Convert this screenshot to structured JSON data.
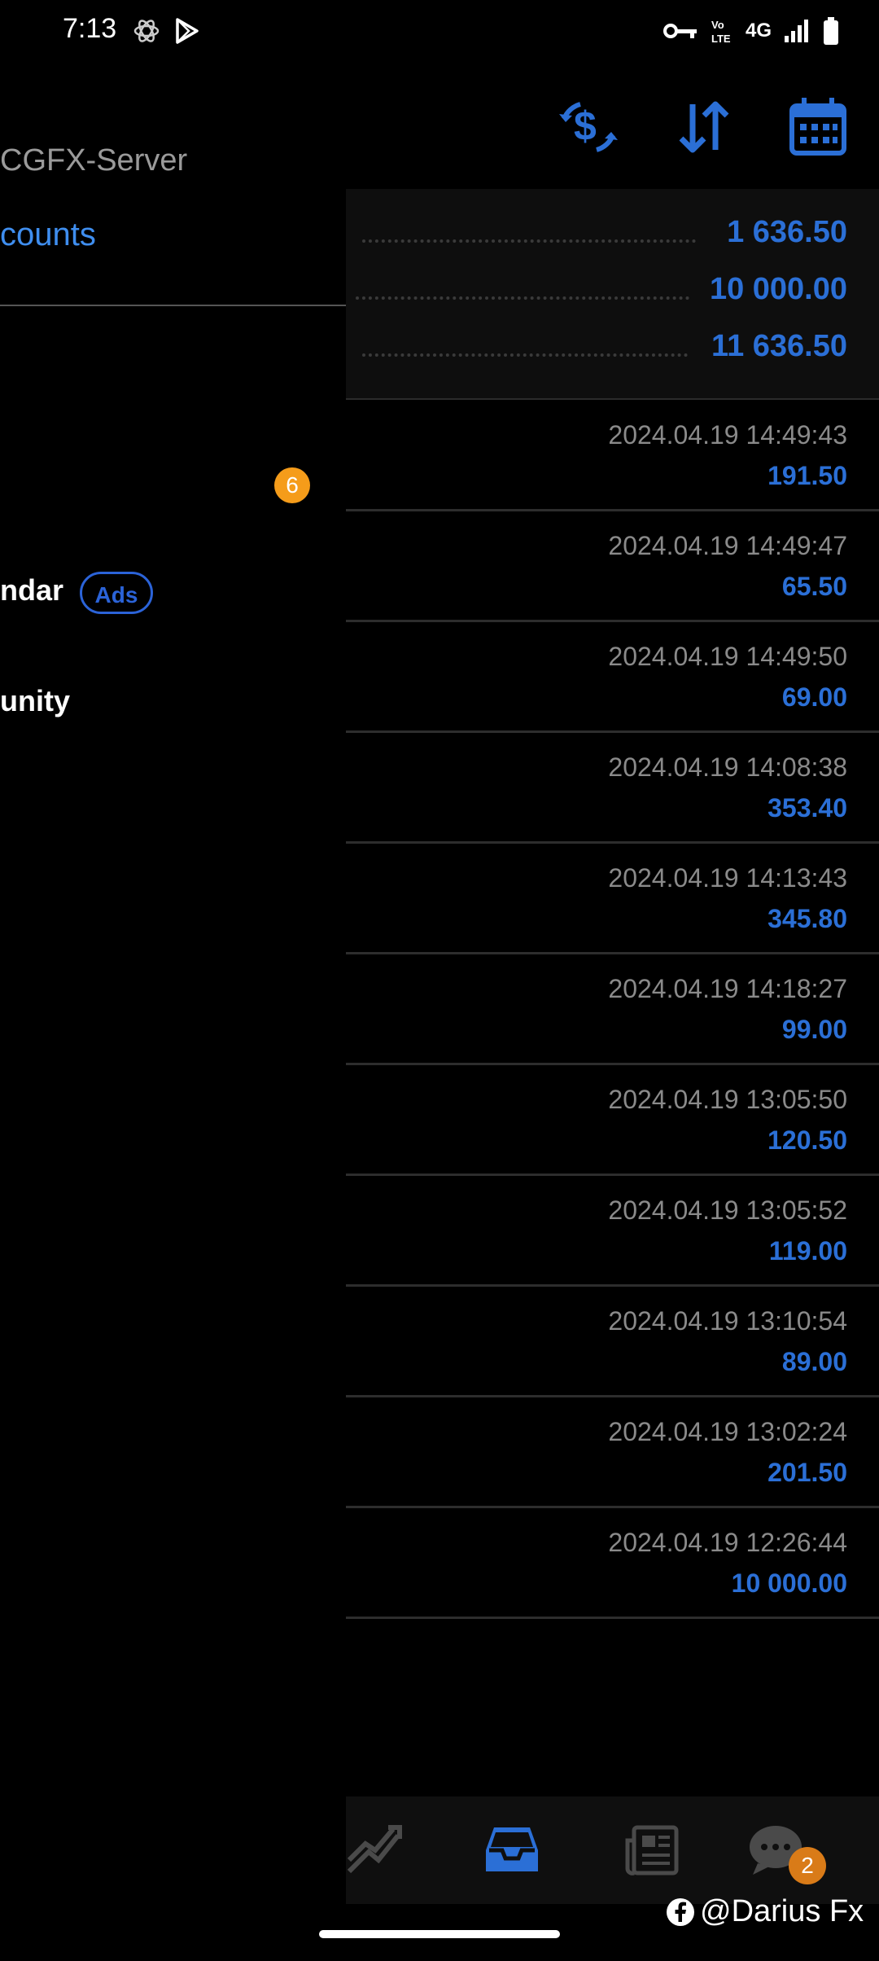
{
  "status_bar": {
    "time": "7:13",
    "network": "4G",
    "icons": [
      "atom-icon",
      "play-store-icon",
      "vpn-key-icon",
      "volte-icon",
      "signal-icon",
      "battery-icon"
    ]
  },
  "drawer": {
    "server": "CGFX-Server",
    "accounts_link": "counts",
    "mail_badge": "6",
    "calendar_label": "ndar",
    "ads_label": "Ads",
    "community_label": "unity"
  },
  "summary": {
    "rows": [
      {
        "value": "1 636.50"
      },
      {
        "value": "10 000.00"
      },
      {
        "value": "11 636.50"
      }
    ]
  },
  "deals": [
    {
      "time": "2024.04.19 14:49:43",
      "amount": "191.50"
    },
    {
      "time": "2024.04.19 14:49:47",
      "amount": "65.50"
    },
    {
      "time": "2024.04.19 14:49:50",
      "amount": "69.00"
    },
    {
      "time": "2024.04.19 14:08:38",
      "amount": "353.40"
    },
    {
      "time": "2024.04.19 14:13:43",
      "amount": "345.80"
    },
    {
      "time": "2024.04.19 14:18:27",
      "amount": "99.00"
    },
    {
      "time": "2024.04.19 13:05:50",
      "amount": "120.50"
    },
    {
      "time": "2024.04.19 13:05:52",
      "amount": "119.00"
    },
    {
      "time": "2024.04.19 13:10:54",
      "amount": "89.00"
    },
    {
      "time": "2024.04.19 13:02:24",
      "amount": "201.50"
    },
    {
      "time": "2024.04.19 12:26:44",
      "amount": "10 000.00"
    }
  ],
  "bottom_nav": {
    "chat_badge": "2"
  },
  "watermark": "@Darius Fx",
  "colors": {
    "accent": "#2b6fd6",
    "badge_orange": "#f59c1a",
    "link_blue": "#3f8eef"
  }
}
